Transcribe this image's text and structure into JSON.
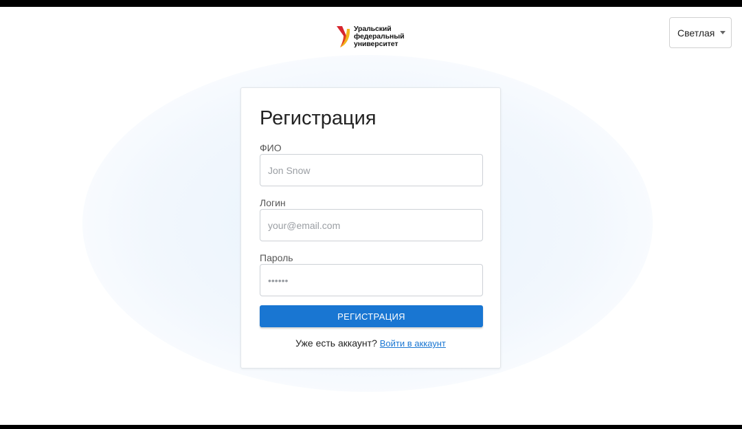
{
  "logo": {
    "lines": [
      "Уральский",
      "федеральный",
      "университет"
    ]
  },
  "theme_select": {
    "value": "Светлая"
  },
  "form": {
    "title": "Регистрация",
    "fields": [
      {
        "label": "ФИО",
        "placeholder": "Jon Snow",
        "value": ""
      },
      {
        "label": "Логин",
        "placeholder": "your@email.com",
        "value": ""
      },
      {
        "label": "Пароль",
        "placeholder": "••••••",
        "value": ""
      }
    ],
    "submit_label": "РЕГИСТРАЦИЯ",
    "footer_text": "Уже есть аккаунт?",
    "login_link": "Войти в аккаунт"
  },
  "colors": {
    "accent": "#1976d2",
    "logo_red": "#d7262f",
    "logo_yellow": "#f2b51d"
  }
}
